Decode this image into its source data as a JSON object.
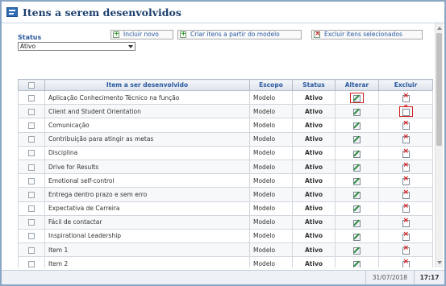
{
  "window": {
    "title": "Itens a serem desenvolvidos"
  },
  "filter": {
    "label": "Status",
    "selected": "Ativo"
  },
  "toolbar": {
    "add_label": "Incluir novo",
    "create_from_model_label": "Criar itens a partir do modelo",
    "delete_selected_label": "Excluir itens selecionados"
  },
  "table": {
    "headers": {
      "item": "Item a ser desenvolvido",
      "scope": "Escopo",
      "status": "Status",
      "edit": "Alterar",
      "delete": "Excluir"
    },
    "rows": [
      {
        "name": "Aplicação Conhecimento Técnico na função",
        "scope": "Modelo",
        "status": "Ativo"
      },
      {
        "name": "Client and Student Orientation",
        "scope": "Modelo",
        "status": "Ativo"
      },
      {
        "name": "Comunicação",
        "scope": "Modelo",
        "status": "Ativo"
      },
      {
        "name": "Contribuição para atingir as metas",
        "scope": "Modelo",
        "status": "Ativo"
      },
      {
        "name": "Disciplina",
        "scope": "Modelo",
        "status": "Ativo"
      },
      {
        "name": "Drive for Results",
        "scope": "Modelo",
        "status": "Ativo"
      },
      {
        "name": "Emotional self-control",
        "scope": "Modelo",
        "status": "Ativo"
      },
      {
        "name": "Entrega dentro prazo e sem erro",
        "scope": "Modelo",
        "status": "Ativo"
      },
      {
        "name": "Expectativa de Carreira",
        "scope": "Modelo",
        "status": "Ativo"
      },
      {
        "name": "Fácil de contactar",
        "scope": "Modelo",
        "status": "Ativo"
      },
      {
        "name": "Inspirational Leadership",
        "scope": "Modelo",
        "status": "Ativo"
      },
      {
        "name": "Item 1",
        "scope": "Modelo",
        "status": "Ativo"
      },
      {
        "name": "Item 2",
        "scope": "Modelo",
        "status": "Ativo"
      }
    ]
  },
  "statusbar": {
    "date": "31/07/2018",
    "time": "17:17"
  },
  "colors": {
    "accent": "#2b5aa0",
    "status_active": "#2e8b1e",
    "highlight": "#d21f1f"
  },
  "icons": {
    "edit": "edit-icon",
    "delete": "delete-icon",
    "title": "window-icon"
  }
}
